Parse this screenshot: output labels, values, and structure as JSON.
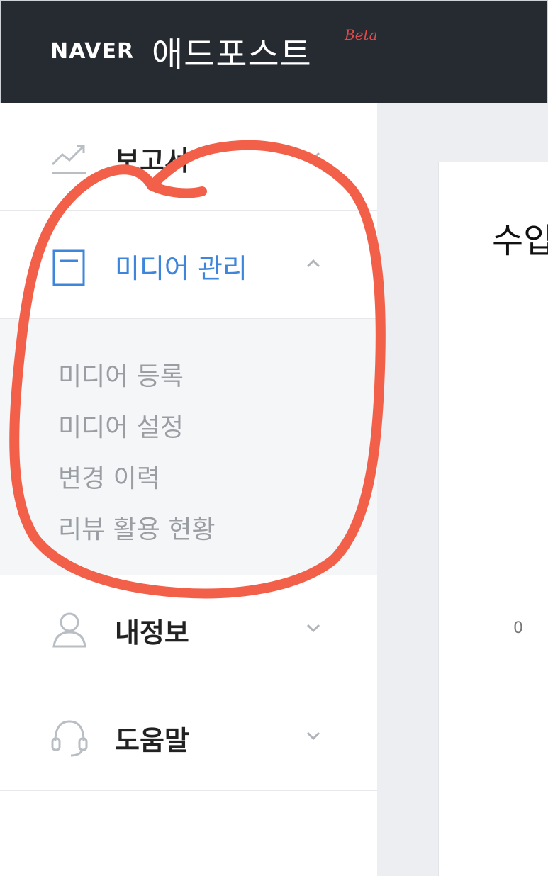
{
  "header": {
    "brand": "NAVER",
    "product": "애드포스트",
    "badge": "Beta"
  },
  "sidebar": {
    "items": [
      {
        "label": "보고서",
        "icon": "chart-line-icon",
        "expanded": false
      },
      {
        "label": "미디어 관리",
        "icon": "document-icon",
        "expanded": true,
        "children": [
          "미디어 등록",
          "미디어 설정",
          "변경 이력",
          "리뷰 활용 현황"
        ]
      },
      {
        "label": "내정보",
        "icon": "user-icon",
        "expanded": false
      },
      {
        "label": "도움말",
        "icon": "headset-icon",
        "expanded": false
      }
    ]
  },
  "main": {
    "title_partial": "수입",
    "axis_value": "0"
  },
  "colors": {
    "header_bg": "#262b31",
    "active": "#3d86dc",
    "annotation": "#f2604a"
  }
}
